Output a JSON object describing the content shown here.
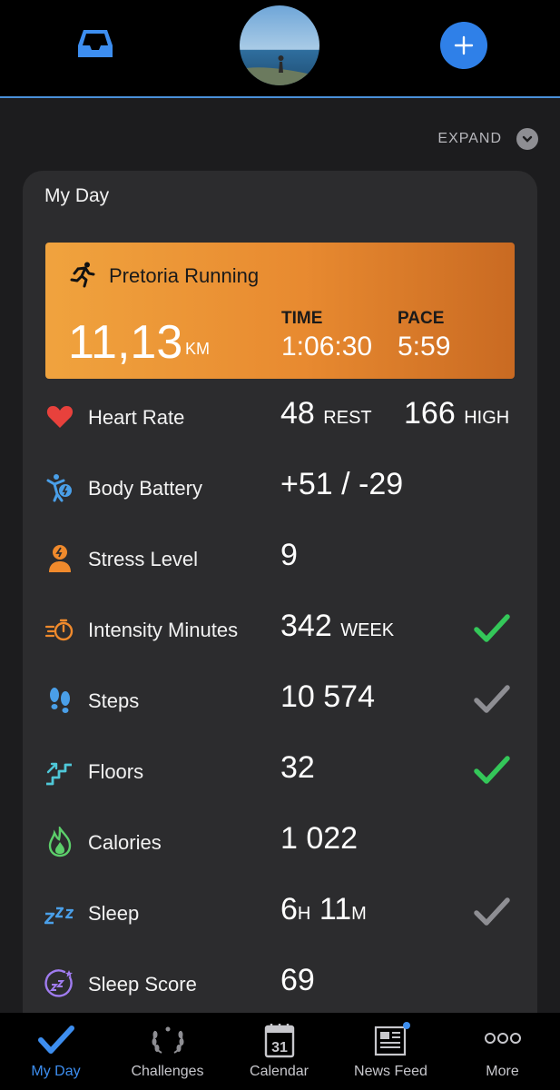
{
  "header": {
    "inbox_icon": "inbox-tray-icon",
    "avatar_icon": "profile-photo",
    "add_icon": "plus-icon"
  },
  "expand": {
    "label": "EXPAND",
    "icon": "chevron-down-icon"
  },
  "card": {
    "title": "My Day",
    "activity": {
      "icon": "running-icon",
      "name": "Pretoria Running",
      "distance": "11,13",
      "distance_unit": "KM",
      "time_label": "TIME",
      "time": "1:06:30",
      "pace_label": "PACE",
      "pace": "5:59"
    },
    "rows": [
      {
        "label": "Heart Rate",
        "icon": "heart-icon",
        "value": "48",
        "value_unit": "REST",
        "value2": "166",
        "value2_unit": "HIGH",
        "check": ""
      },
      {
        "label": "Body Battery",
        "icon": "body-battery-icon",
        "value": "+51 / -29",
        "value_unit": "",
        "check": ""
      },
      {
        "label": "Stress Level",
        "icon": "stress-icon",
        "value": "9",
        "value_unit": "",
        "check": ""
      },
      {
        "label": "Intensity Minutes",
        "icon": "stopwatch-icon",
        "value": "342",
        "value_unit": "WEEK",
        "check": "green"
      },
      {
        "label": "Steps",
        "icon": "footsteps-icon",
        "value": "10 574",
        "value_unit": "",
        "check": "gray"
      },
      {
        "label": "Floors",
        "icon": "stairs-icon",
        "value": "32",
        "value_unit": "",
        "check": "green"
      },
      {
        "label": "Calories",
        "icon": "flame-icon",
        "value": "1 022",
        "value_unit": "",
        "check": ""
      },
      {
        "label": "Sleep",
        "icon": "zzz-icon",
        "value_h": "6",
        "unit_h": "H",
        "value_m": "11",
        "unit_m": "M",
        "check": "gray"
      },
      {
        "label": "Sleep Score",
        "icon": "sleep-score-icon",
        "value": "69",
        "value_unit": "",
        "check": ""
      }
    ]
  },
  "nav": [
    {
      "label": "My Day",
      "icon": "checkmark-icon",
      "active": true
    },
    {
      "label": "Challenges",
      "icon": "laurel-icon",
      "active": false
    },
    {
      "label": "Calendar",
      "icon": "calendar-icon",
      "day": "31",
      "active": false
    },
    {
      "label": "News Feed",
      "icon": "newspaper-icon",
      "active": false
    },
    {
      "label": "More",
      "icon": "more-dots-icon",
      "active": false
    }
  ],
  "colors": {
    "accent_blue": "#2f80e8",
    "check_green": "#34c759",
    "check_gray": "#8e8e93",
    "activity_orange": "#e88a30",
    "heart_red": "#e8413c"
  }
}
